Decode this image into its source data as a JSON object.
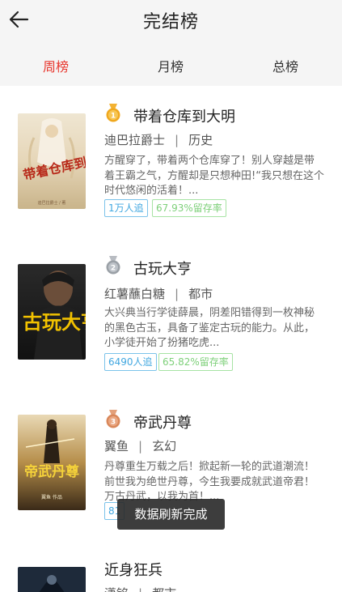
{
  "header": {
    "title": "完结榜"
  },
  "tabs": [
    {
      "label": "周榜",
      "active": true
    },
    {
      "label": "月榜",
      "active": false
    },
    {
      "label": "总榜",
      "active": false
    }
  ],
  "books": [
    {
      "rank": "1",
      "title": "带着仓库到大明",
      "author": "迪巴拉爵士",
      "category": "历史",
      "description": "方醒穿了，带着两个仓库穿了！别人穿越是带着王霸之气，方醒却是只想种田!“我只想在这个时代悠闲的活着！...",
      "followers": "1万人追",
      "retention": "67.93%留存率",
      "cover_text": "带着仓库到大明",
      "cover_author": "迪巴拉爵士 / 著"
    },
    {
      "rank": "2",
      "title": "古玩大亨",
      "author": "红薯蘸白糖",
      "category": "都市",
      "description": "大兴典当行学徒薛晨，阴差阳错得到一枚神秘的黑色古玉，具备了鉴定古玩的能力。从此，小学徒开始了扮猪吃虎...",
      "followers": "6490人追",
      "retention": "65.82%留存率",
      "cover_text": "古玩大亨"
    },
    {
      "rank": "3",
      "title": "帝武丹尊",
      "author": "翼鱼",
      "category": "玄幻",
      "description": "丹尊重生万载之后！掀起新一轮的武道潮流！前世我为绝世丹尊，今生我要成就武道帝君！万古丹武，以我为首！...",
      "followers": "81",
      "retention": "",
      "cover_text": "帝武丹尊",
      "cover_author": "翼鱼 作品"
    },
    {
      "rank": "",
      "title": "近身狂兵",
      "author": "潇铭",
      "category": "都市",
      "description": "",
      "followers": "",
      "retention": ""
    }
  ],
  "toast": {
    "text": "数据刷新完成"
  },
  "colors": {
    "accent": "#e8382f",
    "follow_tag": "#41a7e0",
    "retention_tag": "#7ed07a",
    "gold": "#e8a317",
    "silver": "#9aa0a6",
    "bronze": "#d9875a"
  }
}
